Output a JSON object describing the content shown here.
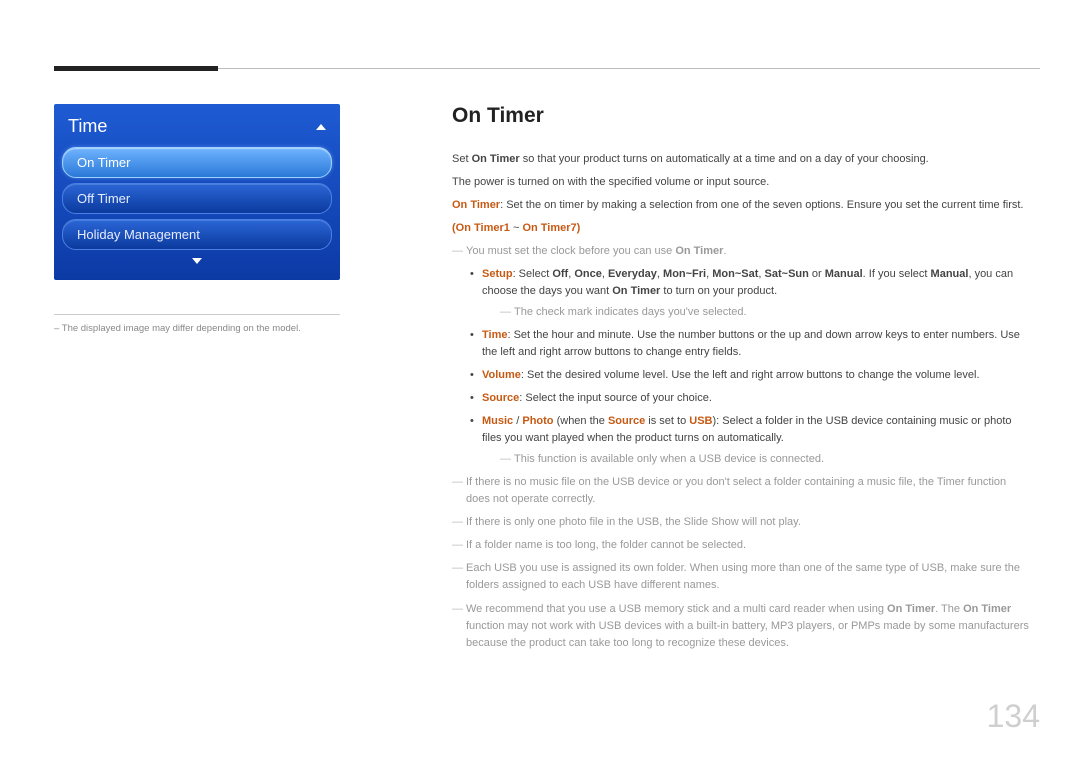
{
  "page_number": "134",
  "menu": {
    "title": "Time",
    "items": [
      {
        "label": "On Timer",
        "selected": true
      },
      {
        "label": "Off Timer",
        "selected": false
      },
      {
        "label": "Holiday Management",
        "selected": false
      }
    ]
  },
  "left_note_prefix": "– ",
  "left_note": "The displayed image may differ depending on the model.",
  "content": {
    "title": "On Timer",
    "intro1_a": "Set ",
    "intro1_b": "On Timer",
    "intro1_c": " so that your product turns on automatically at a time and on a day of your choosing.",
    "intro2": "The power is turned on with the specified volume or input source.",
    "intro3_a": "On Timer",
    "intro3_b": ": Set the on timer by making a selection from one of the seven options. Ensure you set the current time first.",
    "group_a": "On Timer1",
    "group_sep": " ~ ",
    "group_b": "On Timer7",
    "note1_a": "You must set the clock before you can use ",
    "note1_b": "On Timer",
    "note1_c": ".",
    "bullets": {
      "setup_a": "Setup",
      "setup_b": ": Select ",
      "setup_off": "Off",
      "setup_c1": ", ",
      "setup_once": "Once",
      "setup_c2": ", ",
      "setup_everyday": "Everyday",
      "setup_c3": ", ",
      "setup_monfri": "Mon~Fri",
      "setup_c4": ", ",
      "setup_monsat": "Mon~Sat",
      "setup_c5": ", ",
      "setup_satsun": "Sat~Sun",
      "setup_c6": " or ",
      "setup_manual": "Manual",
      "setup_c7": ". If you select ",
      "setup_manual2": "Manual",
      "setup_c8": ", you can choose the days you want ",
      "setup_ontimer": "On Timer",
      "setup_c9": " to turn on your product.",
      "setup_note": "The check mark indicates days you've selected.",
      "time_a": "Time",
      "time_b": ": Set the hour and minute. Use the number buttons or the up and down arrow keys to enter numbers. Use the left and right arrow buttons to change entry fields.",
      "volume_a": "Volume",
      "volume_b": ": Set the desired volume level. Use the left and right arrow buttons to change the volume level.",
      "source_a": "Source",
      "source_b": ": Select the input source of your choice.",
      "music_a": "Music",
      "music_sep": " / ",
      "music_b": "Photo",
      "music_c": " (when the ",
      "music_d": "Source",
      "music_e": " is set to ",
      "music_f": "USB",
      "music_g": "): Select a folder in the USB device containing music or photo files you want played when the product turns on automatically.",
      "music_note": "This function is available only when a USB device is connected."
    },
    "notes": [
      "If there is no music file on the USB device or you don't select a folder containing a music file, the Timer function does not operate correctly.",
      "If there is only one photo file in the USB, the Slide Show will not play.",
      "If a folder name is too long, the folder cannot be selected.",
      "Each USB you use is assigned its own folder. When using more than one of the same type of USB, make sure the folders assigned to each USB have different names."
    ],
    "final_a": "We recommend that you use a USB memory stick and a multi card reader when using ",
    "final_b": "On Timer",
    "final_c": ". The ",
    "final_d": "On Timer",
    "final_e": " function may not work with USB devices with a built-in battery, MP3 players, or PMPs made by some manufacturers because the product can take too long to recognize these devices."
  }
}
